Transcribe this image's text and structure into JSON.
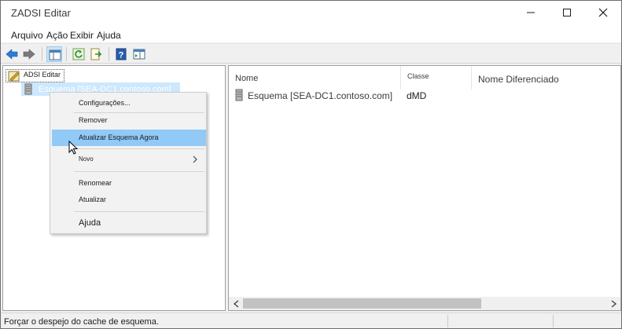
{
  "window": {
    "title": "ZADSI Editar"
  },
  "menubar": {
    "items": [
      "Arquivo",
      "Ação",
      "Exibir",
      "Ajuda"
    ]
  },
  "tree": {
    "root": "ADSI Editar",
    "child": "Esquema [SEA-DC1.contoso.com]"
  },
  "context_menu": {
    "items": [
      "Configurações...",
      "Remover",
      "Atualizar Esquema Agora",
      "Novo",
      "Renomear",
      "Atualizar",
      "Ajuda"
    ],
    "highlighted": "Atualizar Esquema Agora"
  },
  "list": {
    "columns": [
      "Nome",
      "Classe",
      "Nome Diferenciado"
    ],
    "rows": [
      {
        "name": "Esquema [SEA-DC1.contoso.com]",
        "class": "dMD",
        "dn": ""
      }
    ]
  },
  "statusbar": {
    "text": "Forçar o despejo do cache de esquema."
  },
  "colors": {
    "accent": "#91c9f7",
    "selection": "#cce8ff",
    "border": "#a0a0a0"
  },
  "icons": [
    "back-icon",
    "forward-icon",
    "console-tree-icon",
    "refresh-icon",
    "export-list-icon",
    "help-icon",
    "properties-icon",
    "minimize-icon",
    "maximize-icon",
    "close-icon"
  ]
}
